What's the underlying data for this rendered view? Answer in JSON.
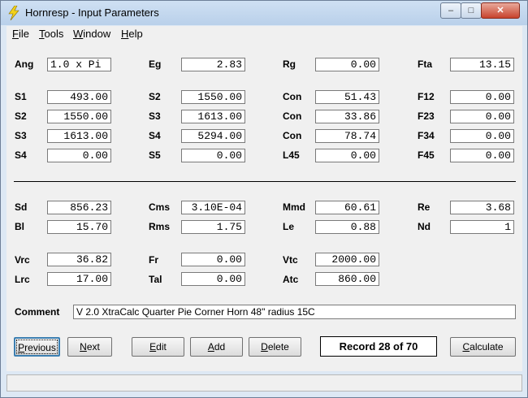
{
  "window": {
    "title": "Hornresp - Input Parameters"
  },
  "controls": {
    "minimize": "–",
    "maximize": "□",
    "close": "✕"
  },
  "menu": [
    "File",
    "Tools",
    "Window",
    "Help"
  ],
  "row1": [
    {
      "label": "Ang",
      "value": "1.0 x Pi"
    },
    {
      "label": "Eg",
      "value": "2.83"
    },
    {
      "label": "Rg",
      "value": "0.00"
    },
    {
      "label": "Fta",
      "value": "13.15"
    }
  ],
  "horn_rows": [
    [
      {
        "label": "S1",
        "value": "493.00"
      },
      {
        "label": "S2",
        "value": "1550.00"
      },
      {
        "label": "Con",
        "value": "51.43"
      },
      {
        "label": "F12",
        "value": "0.00"
      }
    ],
    [
      {
        "label": "S2",
        "value": "1550.00"
      },
      {
        "label": "S3",
        "value": "1613.00"
      },
      {
        "label": "Con",
        "value": "33.86"
      },
      {
        "label": "F23",
        "value": "0.00"
      }
    ],
    [
      {
        "label": "S3",
        "value": "1613.00"
      },
      {
        "label": "S4",
        "value": "5294.00"
      },
      {
        "label": "Con",
        "value": "78.74"
      },
      {
        "label": "F34",
        "value": "0.00"
      }
    ],
    [
      {
        "label": "S4",
        "value": "0.00"
      },
      {
        "label": "S5",
        "value": "0.00"
      },
      {
        "label": "L45",
        "value": "0.00"
      },
      {
        "label": "F45",
        "value": "0.00"
      }
    ]
  ],
  "driver_rows": [
    [
      {
        "label": "Sd",
        "value": "856.23"
      },
      {
        "label": "Cms",
        "value": "3.10E-04"
      },
      {
        "label": "Mmd",
        "value": "60.61"
      },
      {
        "label": "Re",
        "value": "3.68"
      }
    ],
    [
      {
        "label": "Bl",
        "value": "15.70"
      },
      {
        "label": "Rms",
        "value": "1.75"
      },
      {
        "label": "Le",
        "value": "0.88"
      },
      {
        "label": "Nd",
        "value": "1"
      }
    ]
  ],
  "chamber_rows": [
    [
      {
        "label": "Vrc",
        "value": "36.82"
      },
      {
        "label": "Fr",
        "value": "0.00"
      },
      {
        "label": "Vtc",
        "value": "2000.00"
      }
    ],
    [
      {
        "label": "Lrc",
        "value": "17.00"
      },
      {
        "label": "Tal",
        "value": "0.00"
      },
      {
        "label": "Atc",
        "value": "860.00"
      }
    ]
  ],
  "comment": {
    "label": "Comment",
    "value": "V 2.0 XtraCalc Quarter Pie Corner Horn 48\" radius 15C"
  },
  "buttons": {
    "previous": "Previous",
    "next": "Next",
    "edit": "Edit",
    "add": "Add",
    "delete": "Delete",
    "calculate": "Calculate"
  },
  "record": "Record 28 of 70",
  "status": ""
}
